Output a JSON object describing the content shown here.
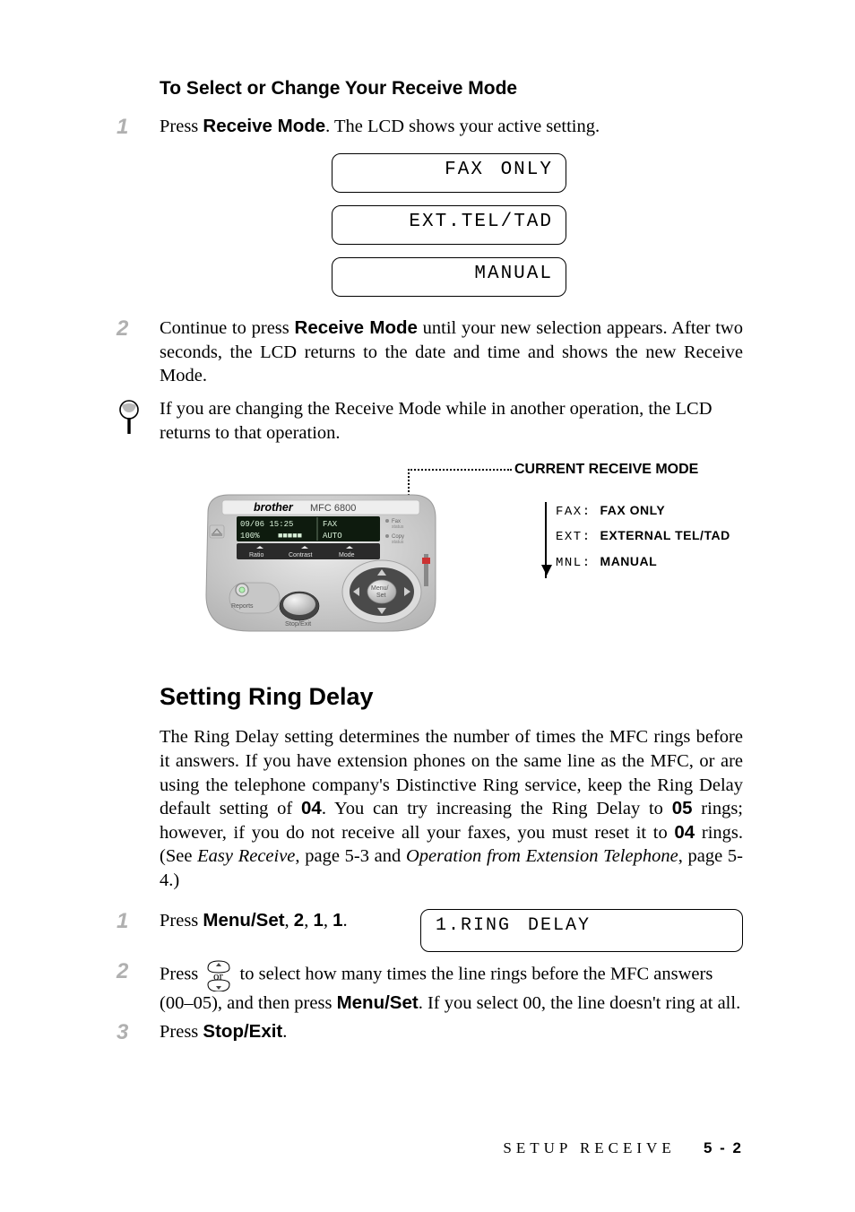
{
  "section1": {
    "heading": "To Select or Change Your Receive Mode",
    "step1": {
      "num": "1",
      "pre": "Press ",
      "bold": "Receive Mode",
      "post": ". The LCD shows your active setting."
    },
    "lcds": [
      "FAX ONLY",
      "EXT.TEL/TAD",
      "MANUAL"
    ],
    "step2": {
      "num": "2",
      "pre": "Continue to press ",
      "bold": "Receive Mode",
      "post": " until your new selection appears. After two seconds, the LCD returns to the date and time and shows the new Receive Mode."
    },
    "note": "If you are changing the Receive Mode while in another operation, the LCD returns to that operation."
  },
  "diagram": {
    "title": "CURRENT RECEIVE MODE",
    "brand": "brother",
    "model": "MFC 6800",
    "display_line1_left": "09/06 15:25",
    "display_line1_right": "FAX",
    "display_line2_left": "100%",
    "display_line2_mid": "■■■■■",
    "display_line2_right": "AUTO",
    "softkeys": [
      "Ratio",
      "Contrast",
      "Mode"
    ],
    "reports": "Reports",
    "stopexit": "Stop/Exit",
    "menuset": "Menu/\nSet",
    "faxstatus": "Fax\nstatus",
    "copystatus": "Copy\nstatus",
    "legend": [
      {
        "code": "FAX",
        "desc": "FAX ONLY"
      },
      {
        "code": "EXT",
        "desc": "EXTERNAL TEL/TAD"
      },
      {
        "code": "MNL",
        "desc": "MANUAL"
      }
    ]
  },
  "section2": {
    "heading": "Setting Ring Delay",
    "para_a": "The Ring Delay setting determines the number of times the MFC rings before it answers.  If you have extension phones on the same line as the MFC, or are using the telephone company's Distinctive Ring service, keep the Ring Delay default setting of ",
    "bold04a": "04",
    "para_b": ". You can try increasing the Ring Delay to ",
    "bold05": "05",
    "para_c": " rings; however, if you do not receive all your faxes, you must reset it to ",
    "bold04b": "04",
    "para_d": " rings. (See ",
    "ital1": "Easy Receive",
    "para_e": ", page 5-3 and ",
    "ital2": "Operation from Extension Telephone",
    "para_f": ", page 5-4.)",
    "step1": {
      "num": "1",
      "pre": "Press ",
      "bold": "Menu/Set",
      "post": ", ",
      "b2": "2",
      "sep": ", ",
      "b3": "1",
      "sep2": ", ",
      "b4": "1",
      "end": "."
    },
    "lcd": "1.RING DELAY",
    "step2": {
      "num": "2",
      "pre": "Press ",
      "nav": "or",
      "post": " to select how many times the line rings before the MFC answers (00–05), and then press ",
      "bold": "Menu/Set",
      "end": ". If you select 00, the line doesn't ring at all."
    },
    "step3": {
      "num": "3",
      "pre": "Press ",
      "bold": "Stop/Exit",
      "end": "."
    }
  },
  "footer": {
    "section": "SETUP RECEIVE",
    "page": "5 - 2"
  }
}
